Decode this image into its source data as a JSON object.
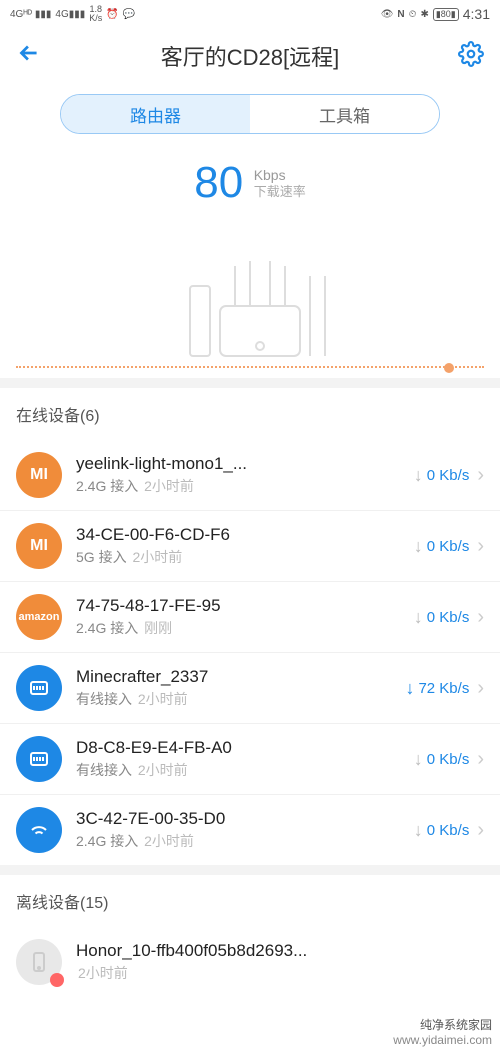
{
  "status": {
    "signal1": "4G",
    "signal2": "4G",
    "net_speed_top": "1.8",
    "net_speed_bot": "K/s",
    "nfc": "N",
    "battery": "80",
    "time": "4:31"
  },
  "nav": {
    "title": "客厅的CD28[远程]"
  },
  "tabs": {
    "router": "路由器",
    "toolbox": "工具箱"
  },
  "speed": {
    "value": "80",
    "unit": "Kbps",
    "label": "下载速率"
  },
  "sections": {
    "online_label": "在线设备",
    "online_count": "(6)",
    "offline_label": "离线设备",
    "offline_count": "(15)"
  },
  "devices": [
    {
      "name": "yeelink-light-mono1_...",
      "conn": "2.4G 接入",
      "time": "2小时前",
      "speed": "0 Kb/s",
      "icon": "mi",
      "active": false
    },
    {
      "name": "34-CE-00-F6-CD-F6",
      "conn": "5G 接入",
      "time": "2小时前",
      "speed": "0 Kb/s",
      "icon": "mi",
      "active": false
    },
    {
      "name": "74-75-48-17-FE-95",
      "conn": "2.4G 接入",
      "time": "刚刚",
      "speed": "0 Kb/s",
      "icon": "amazon",
      "active": false
    },
    {
      "name": "Minecrafter_2337",
      "conn": "有线接入",
      "time": "2小时前",
      "speed": "72 Kb/s",
      "icon": "lan",
      "active": true
    },
    {
      "name": "D8-C8-E9-E4-FB-A0",
      "conn": "有线接入",
      "time": "2小时前",
      "speed": "0 Kb/s",
      "icon": "lan",
      "active": false
    },
    {
      "name": "3C-42-7E-00-35-D0",
      "conn": "2.4G 接入",
      "time": "2小时前",
      "speed": "0 Kb/s",
      "icon": "wifi",
      "active": false
    }
  ],
  "offline_devices": [
    {
      "name": "Honor_10-ffb400f05b8d2693...",
      "conn": "",
      "time": "2小时前",
      "icon": "phone"
    }
  ],
  "watermark": {
    "line1": "纯净系统家园",
    "line2": "www.yidaimei.com"
  },
  "chart_data": {
    "type": "line",
    "title": "",
    "xlabel": "",
    "ylabel": "",
    "series": [
      {
        "name": "download",
        "values": [
          0,
          0,
          0,
          0,
          0,
          0,
          0,
          0,
          0,
          0
        ]
      }
    ],
    "ylim": [
      0,
      100
    ],
    "note": "flat dotted baseline with single end marker; router illustration overlaid"
  }
}
